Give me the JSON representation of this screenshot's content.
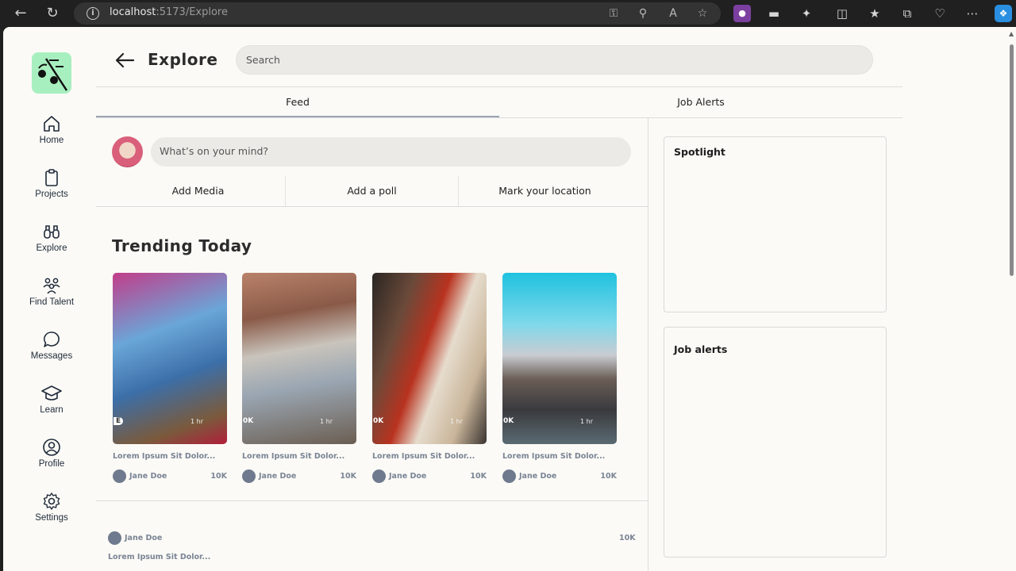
{
  "browser": {
    "url_host": "localhost",
    "url_path": ":5173/Explore"
  },
  "header": {
    "title": "Explore",
    "search_placeholder": "Search"
  },
  "sidebar": {
    "items": [
      {
        "label": "Home",
        "icon": "home-icon"
      },
      {
        "label": "Projects",
        "icon": "clipboard-icon"
      },
      {
        "label": "Explore",
        "icon": "binoculars-icon"
      },
      {
        "label": "Find Talent",
        "icon": "people-icon"
      },
      {
        "label": "Messages",
        "icon": "chat-bubble-icon"
      },
      {
        "label": "Learn",
        "icon": "graduation-cap-icon"
      },
      {
        "label": "Profile",
        "icon": "user-circle-icon"
      },
      {
        "label": "Settings",
        "icon": "gear-icon"
      }
    ]
  },
  "tabs": [
    {
      "label": "Feed",
      "active": true
    },
    {
      "label": "Job Alerts",
      "active": false
    }
  ],
  "composer": {
    "placeholder": "What’s on your mind?",
    "actions": [
      "Add Media",
      "Add a poll",
      "Mark your location"
    ]
  },
  "trending": {
    "title": "Trending Today",
    "cards": [
      {
        "badge": "E",
        "time": "1 hr",
        "caption": "Lorem Ipsum Sit Dolor...",
        "author": "Jane Doe",
        "count": "10K"
      },
      {
        "badge": "0K",
        "time": "1 hr",
        "caption": "Lorem Ipsum Sit Dolor...",
        "author": "Jane Doe",
        "count": "10K"
      },
      {
        "badge": "0K",
        "time": "1 hr",
        "caption": "Lorem Ipsum Sit Dolor...",
        "author": "Jane Doe",
        "count": "10K"
      },
      {
        "badge": "0K",
        "time": "1 hr",
        "caption": "Lorem Ipsum Sit Dolor...",
        "author": "Jane Doe",
        "count": "10K"
      }
    ]
  },
  "post": {
    "author": "Jane Doe",
    "count": "10K",
    "caption": "Lorem Ipsum Sit Dolor..."
  },
  "right_panel": {
    "spotlight_title": "Spotlight",
    "job_alerts_title": "Job alerts"
  },
  "colors": {
    "page_bg": "#fbfaf6",
    "logo_bg": "#a8efbf",
    "input_bg": "#eceae6",
    "tab_underline": "#9aa3b2",
    "muted_text": "#7a8494"
  }
}
